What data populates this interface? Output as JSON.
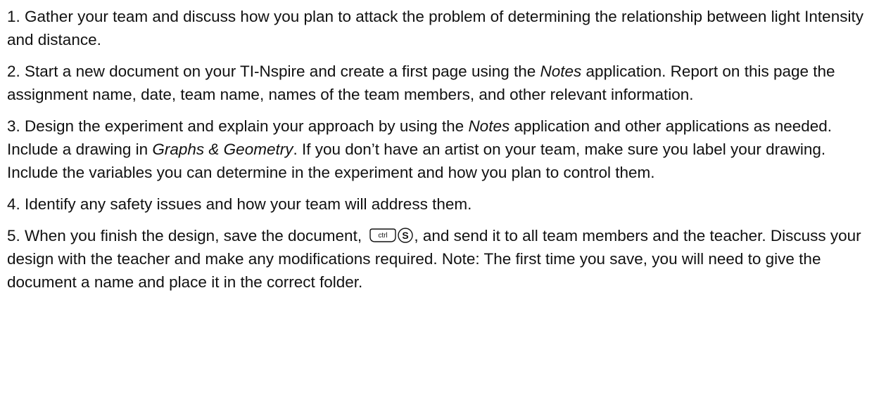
{
  "steps": [
    {
      "number": "1.",
      "parts": [
        "Gather your team and discuss how you plan to attack the problem of determining the relationship between light Intensity and distance."
      ]
    },
    {
      "number": "2.",
      "parts": [
        "Start a new document on your TI-Nspire and create a first page using the ",
        "Notes",
        " application. Report on this page the assignment name, date, team name, names of the team members, and other relevant information."
      ]
    },
    {
      "number": "3.",
      "parts": [
        "Design the experiment and explain your approach by using the ",
        "Notes",
        " application and other applications as needed. Include a drawing in ",
        "Graphs & Geometry",
        ". If you don’t have an artist on your team, make sure you label your drawing. Include the variables you can determine in the experiment and how you plan to control them."
      ]
    },
    {
      "number": "4.",
      "parts": [
        "Identify any safety issues and how your team will address them."
      ]
    },
    {
      "number": "5.",
      "parts": [
        "When you finish the design, save the document, ",
        ", and send it to all team members and the teacher. Discuss your design with the teacher and make any modifications required. Note: The first time you save, you will need to give the document a name and place it in the correct folder."
      ],
      "keys": {
        "ctrl_label": "ctrl",
        "s_label": "S",
        "ctrl_icon": "ctrl-key-icon",
        "s_icon": "s-key-icon"
      }
    }
  ]
}
